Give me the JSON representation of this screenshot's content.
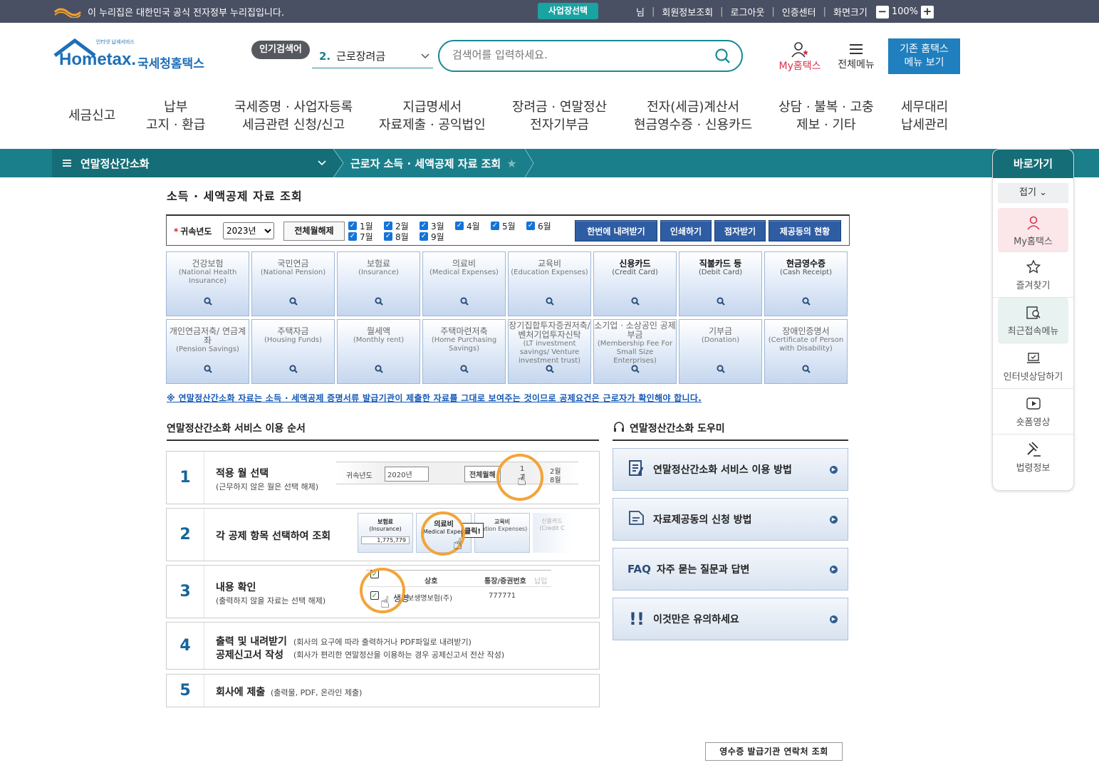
{
  "topbar": {
    "gov_notice": "이 누리집은 대한민국 공식 전자정부 누리집입니다.",
    "biz_select": "사업장선택",
    "user_suffix": "님",
    "links": [
      "회원정보조회",
      "로그아웃",
      "인증센터",
      "화면크기"
    ],
    "zoom_minus": "−",
    "zoom_level": "100%",
    "zoom_plus": "+"
  },
  "header": {
    "logo_small": "인터넷 납세서비스",
    "logo_main": "Hometax.",
    "logo_kr": "국세청홈택스",
    "hot_keyword_label": "인기검색어",
    "hot_keyword_rank": "2.",
    "hot_keyword": "근로장려금",
    "search_placeholder": "검색어를 입력하세요.",
    "my_hometax": "My홈택스",
    "all_menu": "전체메뉴",
    "old_hometax": [
      "기존 홈택스",
      "메뉴 보기"
    ]
  },
  "gnb": [
    [
      "세금신고"
    ],
    [
      "납부",
      "고지 · 환급"
    ],
    [
      "국세증명 · 사업자등록",
      "세금관련 신청/신고"
    ],
    [
      "지급명세서",
      "자료제출 · 공익법인"
    ],
    [
      "장려금 · 연말정산",
      "전자기부금"
    ],
    [
      "전자(세금)계산서",
      "현금영수증 · 신용카드"
    ],
    [
      "상담 · 불복 · 고충",
      "제보 · 기타"
    ],
    [
      "세무대리",
      "납세관리"
    ]
  ],
  "breadcrumb": {
    "menu": "연말정산간소화",
    "current": "근로자 소득 · 세액공제 자료 조회"
  },
  "quick": {
    "title": "바로가기",
    "fold": "접기",
    "items": [
      "My홈택스",
      "즐겨찾기",
      "최근접속메뉴",
      "인터넷상담하기",
      "숏폼영상",
      "법령정보"
    ]
  },
  "page": {
    "title": "소득 · 세액공제 자료 조회",
    "year_label": "귀속년도",
    "year_value": "2023년",
    "clear_all": "전체월해제",
    "months": [
      "1월",
      "2월",
      "3월",
      "4월",
      "5월",
      "6월",
      "7월",
      "8월",
      "9월"
    ],
    "buttons": [
      "한번에 내려받기",
      "인쇄하기",
      "점자받기",
      "제공동의 현황"
    ],
    "notice": "※ 연말정산간소화 자료는 소득 · 세액공제 증명서류 발급기관이 제출한 자료를 그대로 보여주는 것이므로 공제요건은 근로자가 확인해야 합니다."
  },
  "tiles": [
    {
      "k": "건강보험",
      "e": "(National Health Insurance)"
    },
    {
      "k": "국민연금",
      "e": "(National Pension)"
    },
    {
      "k": "보험료",
      "e": "(Insurance)"
    },
    {
      "k": "의료비",
      "e": "(Medical Expenses)"
    },
    {
      "k": "교육비",
      "e": "(Education Expenses)"
    },
    {
      "k": "신용카드",
      "e": "(Credit Card)"
    },
    {
      "k": "직불카드 등",
      "e": "(Debit Card)"
    },
    {
      "k": "현금영수증",
      "e": "(Cash Receipt)"
    },
    {
      "k": "개인연금저축/ 연금계좌",
      "e": "(Pension Savings)"
    },
    {
      "k": "주택자금",
      "e": "(Housing Funds)"
    },
    {
      "k": "월세액",
      "e": "(Monthly rent)"
    },
    {
      "k": "주택마련저축",
      "e": "(Home Purchasing Savings)"
    },
    {
      "k": "장기집합투자증권저축/ 벤처기업투자신탁",
      "e": "(LT investment savings/ Venture investment trust)"
    },
    {
      "k": "소기업 · 소상공인 공제부금",
      "e": "(Membership Fee For Small Size Enterprises)"
    },
    {
      "k": "기부금",
      "e": "(Donation)"
    },
    {
      "k": "장애인증명서",
      "e": "(Certificate of Person with Disability)"
    }
  ],
  "steps_title": "연말정산간소화 서비스 이용 순서",
  "steps": [
    {
      "n": "1",
      "t": "적용 월 선택",
      "s": "(근무하지 않은 월은 선택 해제)"
    },
    {
      "n": "2",
      "t": "각 공제 항목 선택하여 조회",
      "s": ""
    },
    {
      "n": "3",
      "t": "내용 확인",
      "s": "(출력하지 않을 자료는 선택 해제)"
    },
    {
      "n": "4",
      "t": "출력 및 내려받기",
      "s": "(회사의 요구에 따라 출력하거나 PDF파일로 내려받기)",
      "t2": "공제신고서 작성",
      "s2": "(회사가 편리한 연말정산을 이용하는 경우 공제신고서 전산 작성)"
    },
    {
      "n": "5",
      "t": "회사에 제출",
      "s": "(출력물, PDF, 온라인 제출)"
    }
  ],
  "step_illus": {
    "year_label": "귀속년도",
    "year_value": "2020년",
    "clear_all": "전체월해",
    "month_a": "1",
    "month_b": "2월",
    "month_c": "7",
    "month_d": "8월",
    "tile_a": "보험료",
    "tile_a_e": "(Insurance)",
    "tile_a_val": "1,775,779",
    "tile_b": "의료비",
    "tile_b_e": "Medical Expen",
    "tile_c": "교육비",
    "tile_c_e": "ication Expenses)",
    "tile_d": "신용카드",
    "tile_d_e": "(Credit C",
    "click": "클릭!",
    "col_a": "상호",
    "col_b": "통장/증권번호",
    "col_c": "납입",
    "row_a": "생명",
    "row_b": "보생명보험(주)",
    "row_b_val": "777771"
  },
  "helper_title": "연말정산간소화 도우미",
  "helpers": [
    {
      "icon": "",
      "t": "연말정산간소화 서비스 이용 방법"
    },
    {
      "icon": "",
      "t": "자료제공동의 신청 방법"
    },
    {
      "icon": "FAQ",
      "t": "자주 묻는 질문과 답변"
    },
    {
      "icon": "",
      "t": "이것만은 유의하세요"
    }
  ],
  "receipt_button": "영수증 발급기관 연락처 조회",
  "colors": {
    "teal": "#1a7f8a",
    "teal_dark": "#156d77",
    "topbar": "#4a5063",
    "button_blue": "#2e5da4",
    "accent_red": "#d9334d"
  }
}
